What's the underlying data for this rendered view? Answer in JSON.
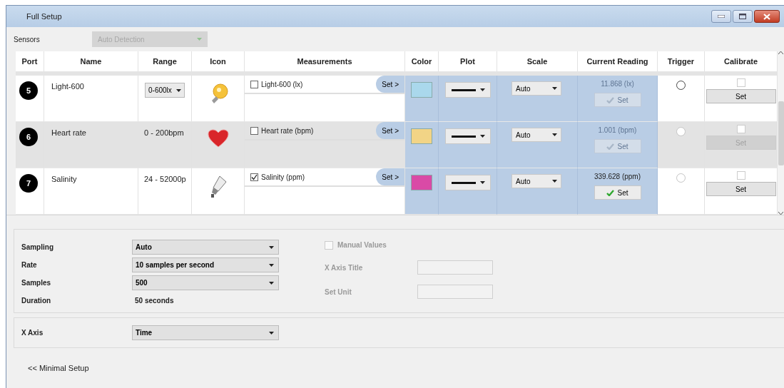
{
  "window": {
    "title": "Full Setup"
  },
  "sensors": {
    "label": "Sensors",
    "value": "Auto Detection",
    "disabled": true
  },
  "table": {
    "columns": [
      "Port",
      "Name",
      "Range",
      "Icon",
      "Measurements",
      "Color",
      "Plot",
      "Scale",
      "Current Reading",
      "Trigger",
      "Calibrate"
    ],
    "rows": [
      {
        "kind": "light",
        "port": "5",
        "name": "Light-600",
        "range": {
          "kind": "dropdown",
          "text": "0-600lx"
        },
        "measurement": {
          "label": "Light-600 (lx)",
          "checked": false
        },
        "set_label": "Set >",
        "color": "#aad8ec",
        "scale": "Auto",
        "reading": "11.868 (lx)",
        "reading_enabled": false,
        "set_button": "Set",
        "trigger_disabled": false,
        "calibrate_checked": false,
        "calibrate_button": "Set",
        "calibrate_enabled": true,
        "selected": false
      },
      {
        "kind": "heart",
        "port": "6",
        "name": "Heart rate",
        "range": {
          "kind": "text",
          "text": "0 - 200bpm"
        },
        "measurement": {
          "label": "Heart rate (bpm)",
          "checked": false
        },
        "set_label": "Set >",
        "color": "#f2d486",
        "scale": "Auto",
        "reading": "1.001 (bpm)",
        "reading_enabled": false,
        "set_button": "Set",
        "trigger_disabled": true,
        "calibrate_checked": false,
        "calibrate_button": "Set",
        "calibrate_enabled": false,
        "selected": true
      },
      {
        "kind": "salinity",
        "port": "7",
        "name": "Salinity",
        "range": {
          "kind": "text",
          "text": "24 - 52000p"
        },
        "measurement": {
          "label": "Salinity (ppm)",
          "checked": true
        },
        "set_label": "Set >",
        "color": "#d94aa6",
        "scale": "Auto",
        "reading": "339.628 (ppm)",
        "reading_enabled": true,
        "set_button": "Set",
        "trigger_disabled": true,
        "calibrate_checked": false,
        "calibrate_button": "Set",
        "calibrate_enabled": true,
        "selected": false
      }
    ]
  },
  "sampling": {
    "fields": [
      {
        "kind": "dropdown",
        "label": "Sampling",
        "value": "Auto"
      },
      {
        "kind": "dropdown",
        "label": "Rate",
        "value": "10 samples per second"
      },
      {
        "kind": "dropdown",
        "label": "Samples",
        "value": "500"
      },
      {
        "kind": "text",
        "label": "Duration",
        "value": "50 seconds"
      }
    ],
    "manual": {
      "label": "Manual Values",
      "checked": false,
      "disabled": true
    },
    "inputs": [
      {
        "label": "X Axis Title",
        "disabled": true
      },
      {
        "label": "Set Unit",
        "disabled": true
      }
    ]
  },
  "x_axis": {
    "label": "X Axis",
    "value": "Time"
  },
  "footer_link": "<< Minimal Setup"
}
